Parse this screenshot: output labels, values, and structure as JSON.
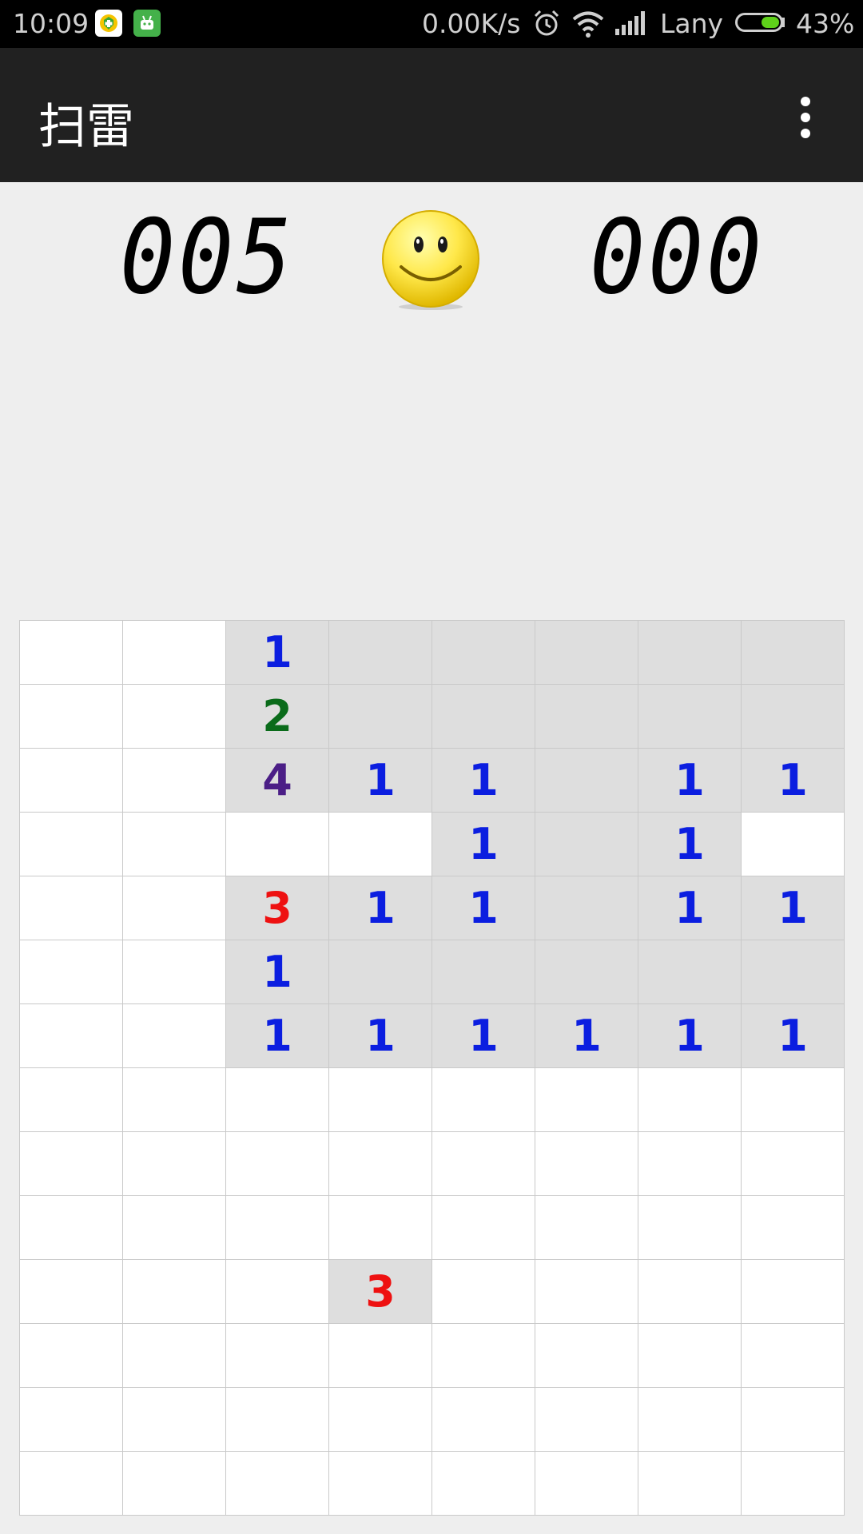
{
  "status_bar": {
    "time": "10:09",
    "speed": "0.00K/s",
    "carrier": "Lany",
    "battery_percent": "43%",
    "battery_level": 0.43,
    "icons": [
      "app-shield-icon",
      "android-app-icon",
      "alarm-icon",
      "wifi-icon",
      "signal-icon",
      "battery-icon"
    ]
  },
  "app_bar": {
    "title": "扫雷",
    "overflow_icon": "more-vert-icon"
  },
  "header": {
    "mine_counter": "005",
    "timer": "000",
    "face": "smiley-face-icon"
  },
  "board": {
    "cols": 8,
    "rows": 14,
    "cells": [
      [
        "",
        "",
        "1r",
        "r",
        "r",
        "r",
        "r",
        "r"
      ],
      [
        "",
        "",
        "2r",
        "r",
        "r",
        "r",
        "r",
        "r"
      ],
      [
        "",
        "",
        "4r",
        "1r",
        "1r",
        "r",
        "1r",
        "1r"
      ],
      [
        "",
        "",
        "",
        "",
        "1r",
        "r",
        "1r",
        ""
      ],
      [
        "",
        "",
        "3r",
        "1r",
        "1r",
        "r",
        "1r",
        "1r"
      ],
      [
        "",
        "",
        "1r",
        "r",
        "r",
        "r",
        "r",
        "r"
      ],
      [
        "",
        "",
        "1r",
        "1r",
        "1r",
        "1r",
        "1r",
        "1r"
      ],
      [
        "",
        "",
        "",
        "",
        "",
        "",
        "",
        ""
      ],
      [
        "",
        "",
        "",
        "",
        "",
        "",
        "",
        ""
      ],
      [
        "",
        "",
        "",
        "",
        "",
        "",
        "",
        ""
      ],
      [
        "",
        "",
        "",
        "3r",
        "",
        "",
        "",
        ""
      ],
      [
        "",
        "",
        "",
        "",
        "",
        "",
        "",
        ""
      ],
      [
        "",
        "",
        "",
        "",
        "",
        "",
        "",
        ""
      ],
      [
        "",
        "",
        "",
        "",
        "",
        "",
        "",
        ""
      ]
    ],
    "number_colors": {
      "1": "#0b1ee0",
      "2": "#0a6b1a",
      "3": "#ee1111",
      "4": "#4b1e86"
    }
  }
}
